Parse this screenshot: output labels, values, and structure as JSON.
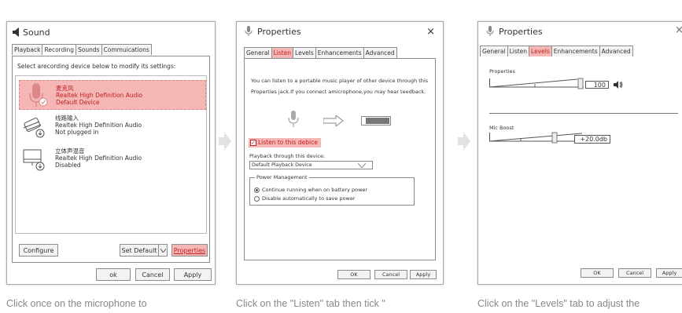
{
  "window1": {
    "title": "Sound",
    "tabs": [
      "Playback",
      "Recording",
      "Sounds",
      "Commuications"
    ],
    "instruction": "Select arecording device below to modify its settings:",
    "devices": [
      {
        "name1": "麦克风",
        "name2": "Realtek High Definition Audio",
        "status": "Default Device",
        "icon": "microphone-icon"
      },
      {
        "name1": "线路输入",
        "name2": "Realtek High Definition Audio",
        "status": "Not plugged in",
        "icon": "line-in-icon"
      },
      {
        "name1": "立体声混音",
        "name2": "Realtek High Definition Audio",
        "status": "Disabled",
        "icon": "stereo-mix-icon"
      }
    ],
    "configure": "Configure",
    "set_default": "Set Default",
    "properties": "Properties",
    "ok": "ok",
    "cancel": "Cancel",
    "apply": "Apply"
  },
  "window2": {
    "title": "Properties",
    "close": "×",
    "tabs": [
      "General",
      "Listen",
      "Levels",
      "Enhancements",
      "Advanced"
    ],
    "desc1": "You can listen to a portable music player of other device through this",
    "desc2": "Properties jack.If you connect amicrophone,you may hear teedback.",
    "listen_checkbox": "Listen to this debice",
    "playback_label": "Playback through this device:",
    "playback_value": "Default Playback Device",
    "power_group": "Power Management",
    "radio1": "Continue running when on battery power",
    "radio2": "Disable automatically to save power",
    "ok": "OK",
    "cancel": "Cancel",
    "apply": "Apply"
  },
  "window3": {
    "title": "Properties",
    "close": "×",
    "tabs": [
      "General",
      "Listen",
      "Levels",
      "Enhancements",
      "Advanced"
    ],
    "properties_label": "Properties",
    "properties_value": "100",
    "properties_level": 100,
    "mic_boost_label": "Mic Boost",
    "mic_boost_value": "+20.0db",
    "ok": "OK",
    "cancel": "Cancel",
    "apply": "Apply"
  },
  "captions": [
    "Click once on the microphone to",
    "Click on the \"Listen\" tab then tick \"",
    "Click on the \"Levels\" tab to adjust the"
  ],
  "colors": {
    "highlight": "#f5b6b6",
    "highlight_text": "#c02020"
  }
}
